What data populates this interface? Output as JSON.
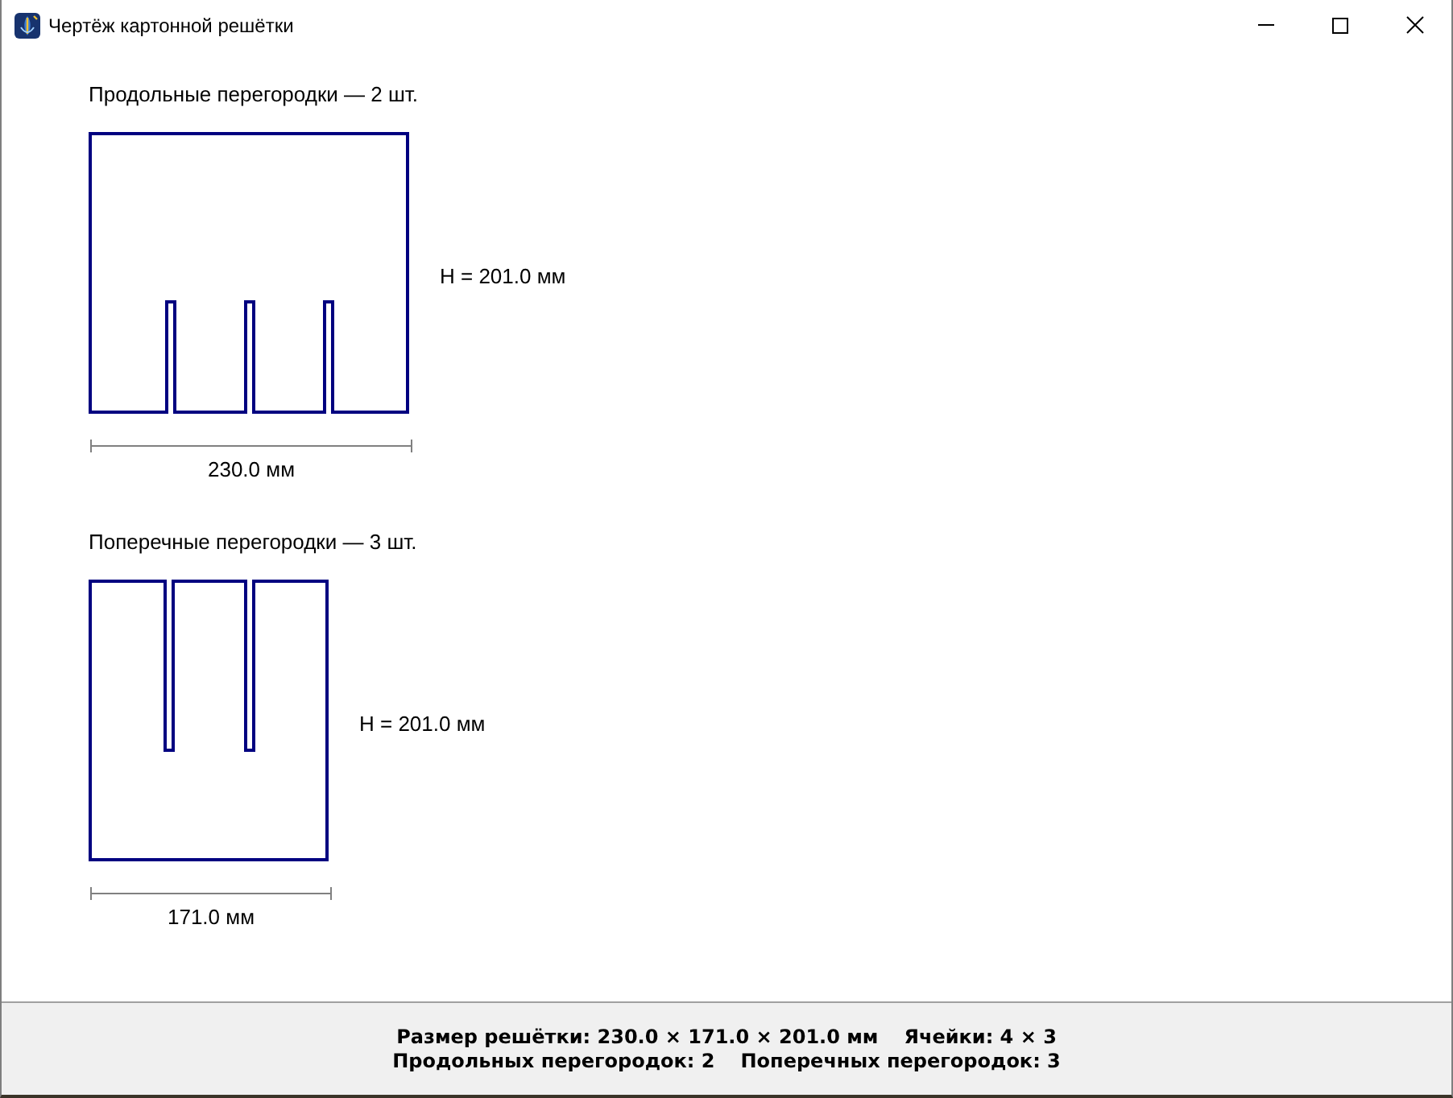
{
  "window": {
    "title": "Чертёж картонной решётки"
  },
  "panels": [
    {
      "kind": "slots_bottom",
      "caption": "Продольные перегородки — 2 шт.",
      "height_label": "H = 201.0 мм",
      "width_label": "230.0 мм"
    },
    {
      "kind": "slots_top",
      "caption": "Поперечные перегородки — 3 шт.",
      "height_label": "H = 201.0 мм",
      "width_label": "171.0 мм"
    }
  ],
  "status_bar": {
    "lines": [
      [
        "Размер решётки: 230.0 × 171.0 × 201.0 мм",
        "Ячейки: 4 × 3"
      ],
      [
        "Продольных перегородок: 2",
        "Поперечных перегородок: 3"
      ]
    ]
  }
}
